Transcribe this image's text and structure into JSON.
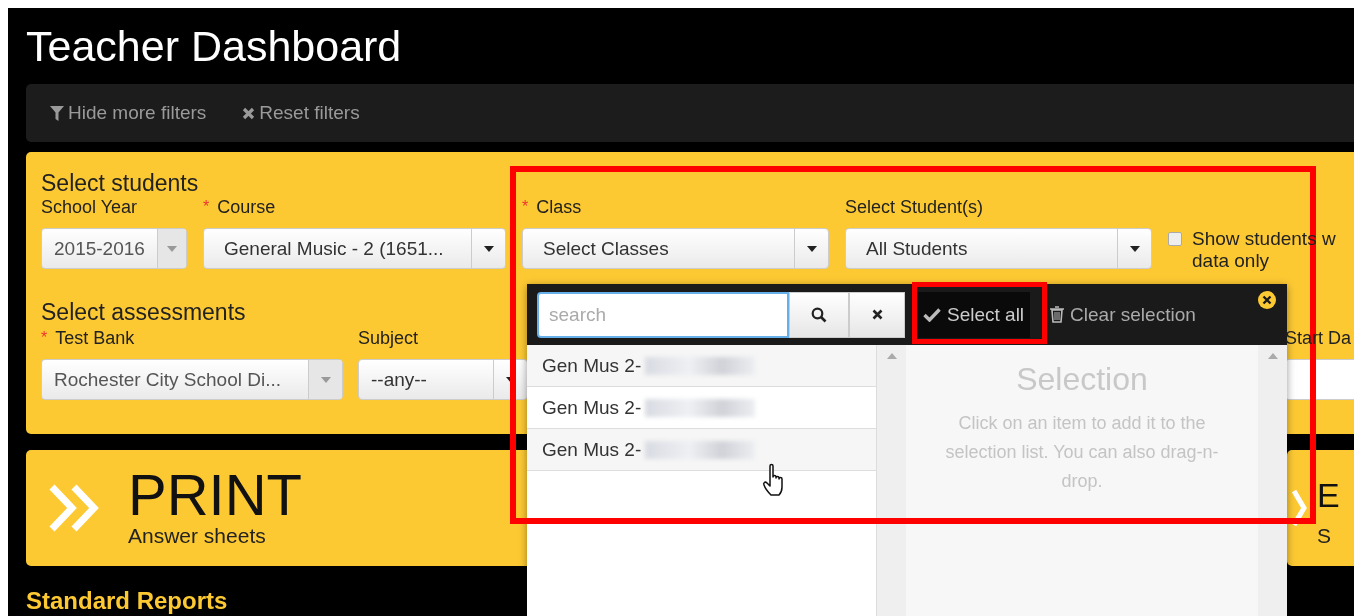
{
  "title": "Teacher Dashboard",
  "toolbar": [
    {
      "kind": "filter",
      "label": "Hide more filters"
    },
    {
      "kind": "reset",
      "label": "Reset filters"
    }
  ],
  "students": {
    "heading": "Select students",
    "fields": [
      {
        "label": "School Year",
        "value": "2015-2016",
        "disabled": true
      },
      {
        "label": "Course",
        "required_mark": "*",
        "value": "General Music - 2 (1651...",
        "disabled": false
      },
      {
        "label": "Class",
        "required_mark": "*",
        "value": "Select Classes",
        "disabled": false
      },
      {
        "label": "Select Student(s)",
        "value": "All Students",
        "disabled": false
      }
    ],
    "checkbox": {
      "lines": [
        "Show students w",
        "data only"
      ],
      "checked": false
    }
  },
  "assessments": {
    "heading": "Select assessments",
    "fields": [
      {
        "label": "Test Bank",
        "required_mark": "*",
        "value": "Rochester City School Di...",
        "disabled": true
      },
      {
        "label": "Subject",
        "value": "--any--",
        "disabled": false
      }
    ],
    "date_label": "Start Da"
  },
  "cards": [
    {
      "title": "PRINT",
      "subtitle": "Answer sheets"
    },
    {
      "title": "E",
      "subtitle": "S"
    }
  ],
  "section_heading": "Standard Reports",
  "picker": {
    "search": {
      "placeholder": "search"
    },
    "actions": [
      {
        "kind": "select",
        "label": "Select all",
        "highlighted": true
      },
      {
        "kind": "clear",
        "label": "Clear selection",
        "highlighted": false
      }
    ],
    "items": [
      {
        "label": "Gen Mus 2-"
      },
      {
        "label": "Gen Mus 2-"
      },
      {
        "label": "Gen Mus 2-"
      }
    ],
    "selection": {
      "heading": "Selection",
      "hint": "Click on an item to add it to the selection list. You can also drag-n-drop."
    }
  }
}
